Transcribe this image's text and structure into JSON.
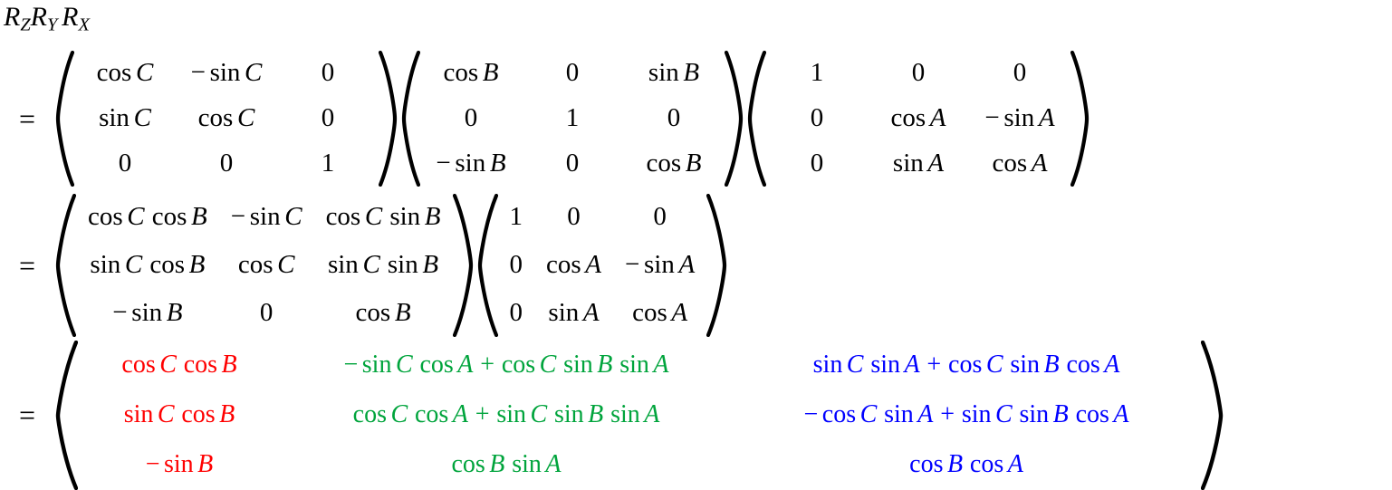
{
  "document": {
    "type": "math-derivation",
    "subject": "Rotation matrix product R_Z R_Y R_X (extrinsic ZYX Euler angles)"
  },
  "colors": {
    "column1": "#ff0000",
    "column2": "#00a43c",
    "column3": "#0000ff",
    "text": "#000000",
    "background": "#ffffff"
  },
  "lhs": {
    "r": "R",
    "sub_z": "Z",
    "sub_y": "Y",
    "sub_x": "X"
  },
  "equals": "=",
  "line1": {
    "matrices": [
      {
        "name": "rotation-z",
        "rows": [
          [
            "cos C",
            "− sin C",
            "0"
          ],
          [
            "sin C",
            "cos C",
            "0"
          ],
          [
            "0",
            "0",
            "1"
          ]
        ]
      },
      {
        "name": "rotation-y",
        "rows": [
          [
            "cos B",
            "0",
            "sin B"
          ],
          [
            "0",
            "1",
            "0"
          ],
          [
            "− sin B",
            "0",
            "cos B"
          ]
        ]
      },
      {
        "name": "rotation-x",
        "rows": [
          [
            "1",
            "0",
            "0"
          ],
          [
            "0",
            "cos A",
            "− sin A"
          ],
          [
            "0",
            "sin A",
            "cos A"
          ]
        ]
      }
    ]
  },
  "line2": {
    "matrices": [
      {
        "name": "rotation-zy-product",
        "rows": [
          [
            "cos C cos B",
            "− sin C",
            "cos C sin B"
          ],
          [
            "sin C cos B",
            "cos C",
            "sin C sin B"
          ],
          [
            "− sin B",
            "0",
            "cos B"
          ]
        ]
      },
      {
        "name": "rotation-x",
        "rows": [
          [
            "1",
            "0",
            "0"
          ],
          [
            "0",
            "cos A",
            "− sin A"
          ],
          [
            "0",
            "sin A",
            "cos A"
          ]
        ]
      }
    ]
  },
  "line3": {
    "matrix": {
      "name": "rotation-zyx-product",
      "rows": [
        [
          "cos C cos B",
          "− sin C cos A + cos C sin B sin A",
          "sin C sin A + cos C sin B cos A"
        ],
        [
          "sin C cos B",
          "cos C cos A + sin C sin B sin A",
          "− cos C sin A + sin C sin B cos A"
        ],
        [
          "− sin B",
          "cos B sin A",
          "cos B cos A"
        ]
      ]
    }
  },
  "symbols": {
    "minus": "−",
    "plus": "+",
    "cos": "cos",
    "sin": "sin",
    "A": "A",
    "B": "B",
    "C": "C",
    "zero": "0",
    "one": "1"
  }
}
